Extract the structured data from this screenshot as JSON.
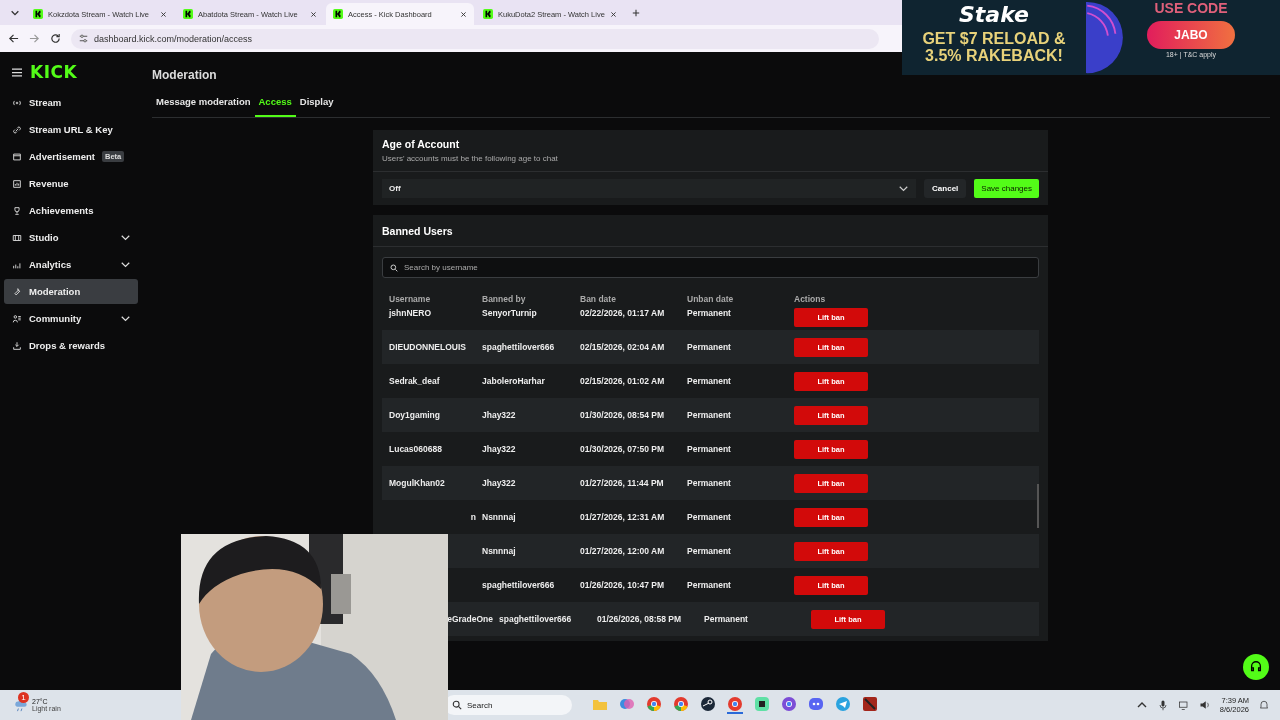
{
  "browser": {
    "tabs": [
      {
        "title": "Kokzdota Stream - Watch Live",
        "selected": false
      },
      {
        "title": "Abatdota Stream - Watch Live",
        "selected": false
      },
      {
        "title": "Access - Kick Dashboard",
        "selected": true
      },
      {
        "title": "KukuDota2 Stream - Watch Live",
        "selected": false
      }
    ],
    "url": "dashboard.kick.com/moderation/access"
  },
  "ad_overlay": {
    "brand": "Stake",
    "headline": "GET $7 RELOAD & 3.5% RAKEBACK!",
    "code_label": "USE CODE",
    "code": "JABO",
    "fine_print": "18+ | T&C apply"
  },
  "sidebar": {
    "logo": "KICK",
    "items": [
      {
        "label": "Stream",
        "selected": false,
        "expandable": false
      },
      {
        "label": "Stream URL & Key",
        "selected": false,
        "expandable": false
      },
      {
        "label": "Advertisement",
        "badge": "Beta",
        "selected": false,
        "expandable": false
      },
      {
        "label": "Revenue",
        "selected": false,
        "expandable": false
      },
      {
        "label": "Achievements",
        "selected": false,
        "expandable": false
      },
      {
        "label": "Studio",
        "selected": false,
        "expandable": true
      },
      {
        "label": "Analytics",
        "selected": false,
        "expandable": true
      },
      {
        "label": "Moderation",
        "selected": true,
        "expandable": false
      },
      {
        "label": "Community",
        "selected": false,
        "expandable": true
      },
      {
        "label": "Drops & rewards",
        "selected": false,
        "expandable": false
      }
    ]
  },
  "page_title": "Moderation",
  "tabs": [
    {
      "label": "Message moderation",
      "selected": false
    },
    {
      "label": "Access",
      "selected": true
    },
    {
      "label": "Display",
      "selected": false
    }
  ],
  "age_of_account": {
    "title": "Age of Account",
    "description": "Users' accounts must be the following age to chat",
    "value": "Off",
    "cancel": "Cancel",
    "save": "Save changes"
  },
  "banned_users": {
    "title": "Banned Users",
    "search_placeholder": "Search by username",
    "columns": [
      "Username",
      "Banned by",
      "Ban date",
      "Unban date",
      "Actions"
    ],
    "rows": [
      {
        "username": "jshnNERO",
        "banned_by": "SenyorTurnip",
        "ban_date": "02/22/2026, 01:17 AM",
        "unban_date": "Permanent",
        "action": "Lift ban"
      },
      {
        "username": "DIEUDONNELOUIS",
        "banned_by": "spaghettilover666",
        "ban_date": "02/15/2026, 02:04 AM",
        "unban_date": "Permanent",
        "action": "Lift ban"
      },
      {
        "username": "Sedrak_deaf",
        "banned_by": "JaboleroHarhar",
        "ban_date": "02/15/2026, 01:02 AM",
        "unban_date": "Permanent",
        "action": "Lift ban"
      },
      {
        "username": "Doy1gaming",
        "banned_by": "Jhay322",
        "ban_date": "01/30/2026, 08:54 PM",
        "unban_date": "Permanent",
        "action": "Lift ban"
      },
      {
        "username": "Lucas060688",
        "banned_by": "Jhay322",
        "ban_date": "01/30/2026, 07:50 PM",
        "unban_date": "Permanent",
        "action": "Lift ban"
      },
      {
        "username": "MogulKhan02",
        "banned_by": "Jhay322",
        "ban_date": "01/27/2026, 11:44 PM",
        "unban_date": "Permanent",
        "action": "Lift ban"
      },
      {
        "username": "n",
        "banned_by": "Nsnnnaj",
        "ban_date": "01/27/2026, 12:31 AM",
        "unban_date": "Permanent",
        "action": "Lift ban"
      },
      {
        "banned_by": "Nsnnnaj",
        "ban_date": "01/27/2026, 12:00 AM",
        "unban_date": "Permanent",
        "action": "Lift ban"
      },
      {
        "banned_by": "spaghettilover666",
        "ban_date": "01/26/2026, 10:47 PM",
        "unban_date": "Permanent",
        "action": "Lift ban"
      },
      {
        "username": "eGradeOne",
        "banned_by": "spaghettilover666",
        "ban_date": "01/26/2026, 08:58 PM",
        "unban_date": "Permanent",
        "action": "Lift ban"
      }
    ]
  },
  "taskbar": {
    "weather_badge": "1",
    "temperature": "27°C",
    "weather": "Light rain",
    "search": "Search",
    "time": "7:39 AM",
    "date": "8/6/2026"
  }
}
